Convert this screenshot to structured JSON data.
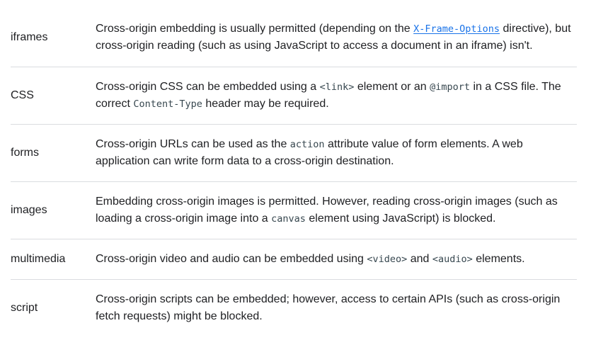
{
  "rows": [
    {
      "term": "iframes",
      "parts": [
        "Cross-origin embedding is usually permitted (depending on the ",
        "X-Frame-Options",
        " directive), but cross-origin reading (such as using JavaScript to access a document in an iframe) isn't."
      ]
    },
    {
      "term": "CSS",
      "parts": [
        "Cross-origin CSS can be embedded using a ",
        "<link>",
        " element or an ",
        "@import",
        " in a CSS file. The correct ",
        "Content-Type",
        " header may be required."
      ]
    },
    {
      "term": "forms",
      "parts": [
        "Cross-origin URLs can be used as the ",
        "action",
        " attribute value of form elements. A web application can write form data to a cross-origin destination."
      ]
    },
    {
      "term": "images",
      "parts": [
        "Embedding cross-origin images is permitted. However, reading cross-origin images (such as loading a cross-origin image into a ",
        "canvas",
        " element using JavaScript) is blocked."
      ]
    },
    {
      "term": "multimedia",
      "parts": [
        "Cross-origin video and audio can be embedded using ",
        "<video>",
        " and ",
        "<audio>",
        " elements."
      ]
    },
    {
      "term": "script",
      "parts": [
        "Cross-origin scripts can be embedded; however, access to certain APIs (such as cross-origin fetch requests) might be blocked."
      ]
    }
  ]
}
